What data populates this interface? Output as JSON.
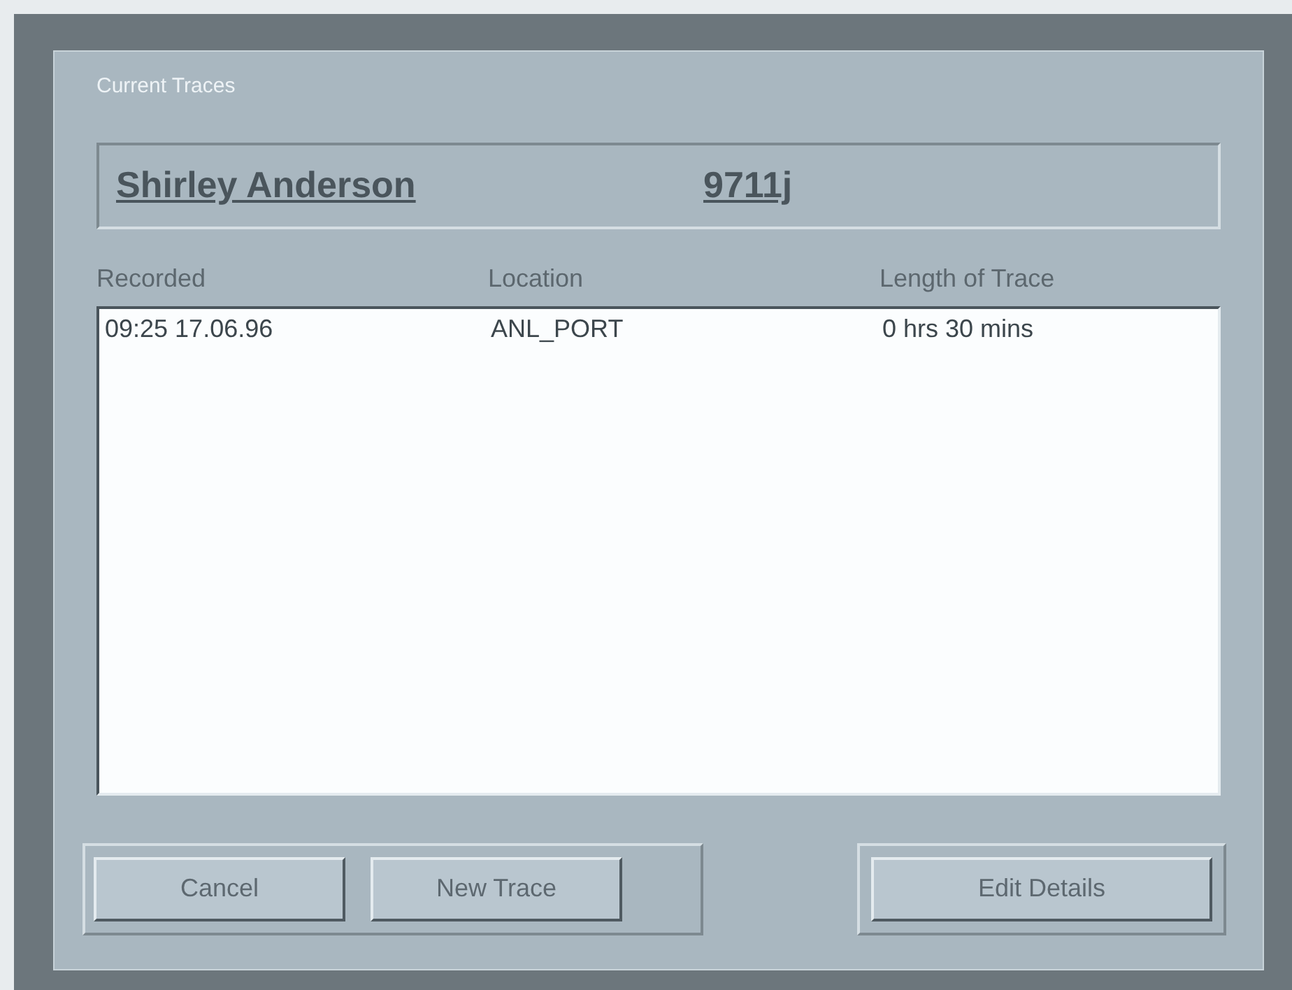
{
  "window": {
    "title": "Current Traces"
  },
  "patient": {
    "name": "Shirley  Anderson",
    "id": "9711j"
  },
  "table": {
    "columns": [
      "Recorded",
      "Location",
      "Length of Trace"
    ],
    "rows": [
      [
        "09:25  17.06.96",
        "ANL_PORT",
        "0 hrs 30 mins"
      ]
    ]
  },
  "button_groups": [
    [
      "Cancel",
      "New Trace"
    ],
    [
      "Edit Details"
    ]
  ]
}
